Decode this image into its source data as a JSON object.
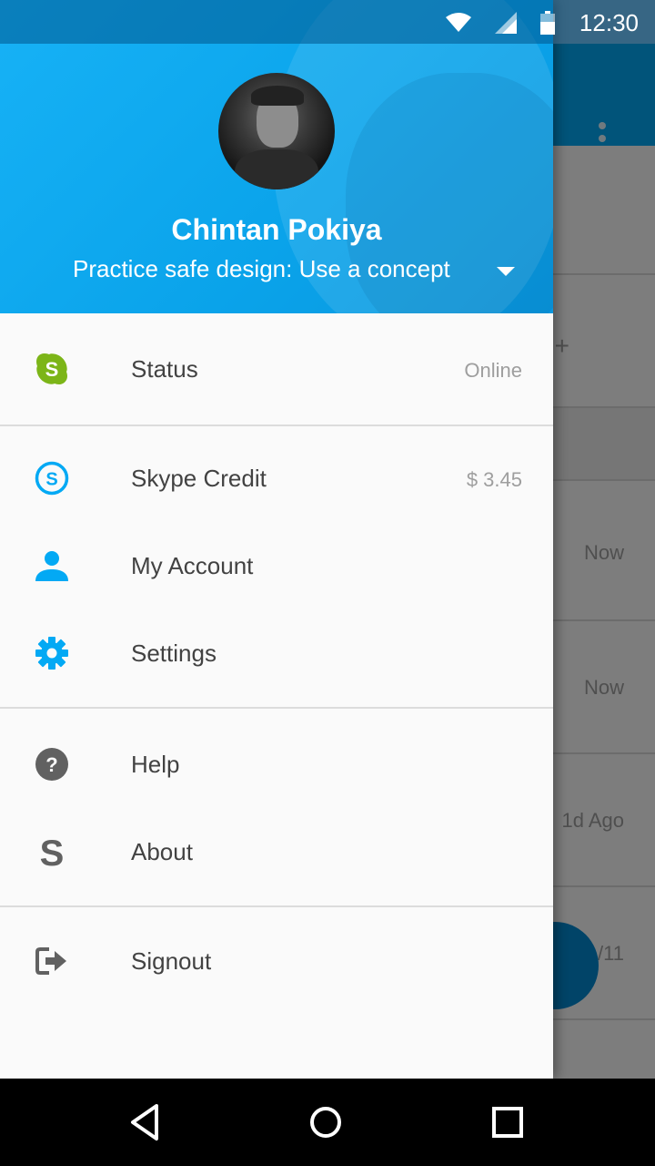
{
  "status_bar": {
    "time": "12:30",
    "icons": [
      "wifi-icon",
      "cell-signal-icon",
      "battery-icon"
    ]
  },
  "background_list": {
    "rows": [
      {
        "meta": ""
      },
      {
        "meta": "+"
      },
      {
        "meta": ""
      },
      {
        "meta": "Now"
      },
      {
        "meta": "Now"
      },
      {
        "meta": "1d Ago"
      },
      {
        "meta": "/11"
      },
      {
        "meta": ""
      }
    ]
  },
  "drawer": {
    "header": {
      "name": "Chintan Pokiya",
      "mood": "Practice safe design: Use a concept"
    },
    "items": [
      {
        "icon": "skype-status-icon",
        "label": "Status",
        "value": "Online"
      },
      {
        "icon": "skype-credit-icon",
        "label": "Skype Credit",
        "value": "$ 3.45"
      },
      {
        "icon": "person-icon",
        "label": "My Account",
        "value": ""
      },
      {
        "icon": "gear-icon",
        "label": "Settings",
        "value": ""
      },
      {
        "icon": "help-icon",
        "label": "Help",
        "value": ""
      },
      {
        "icon": "skype-s-icon",
        "label": "About",
        "value": ""
      },
      {
        "icon": "signout-icon",
        "label": "Signout",
        "value": ""
      }
    ]
  },
  "colors": {
    "accent": "#03a9f4",
    "status_green": "#7cb518",
    "icon_blue": "#03a9f4",
    "icon_grey": "#616161"
  },
  "nav_bar": {
    "buttons": [
      "back-icon",
      "home-icon",
      "recents-icon"
    ]
  }
}
